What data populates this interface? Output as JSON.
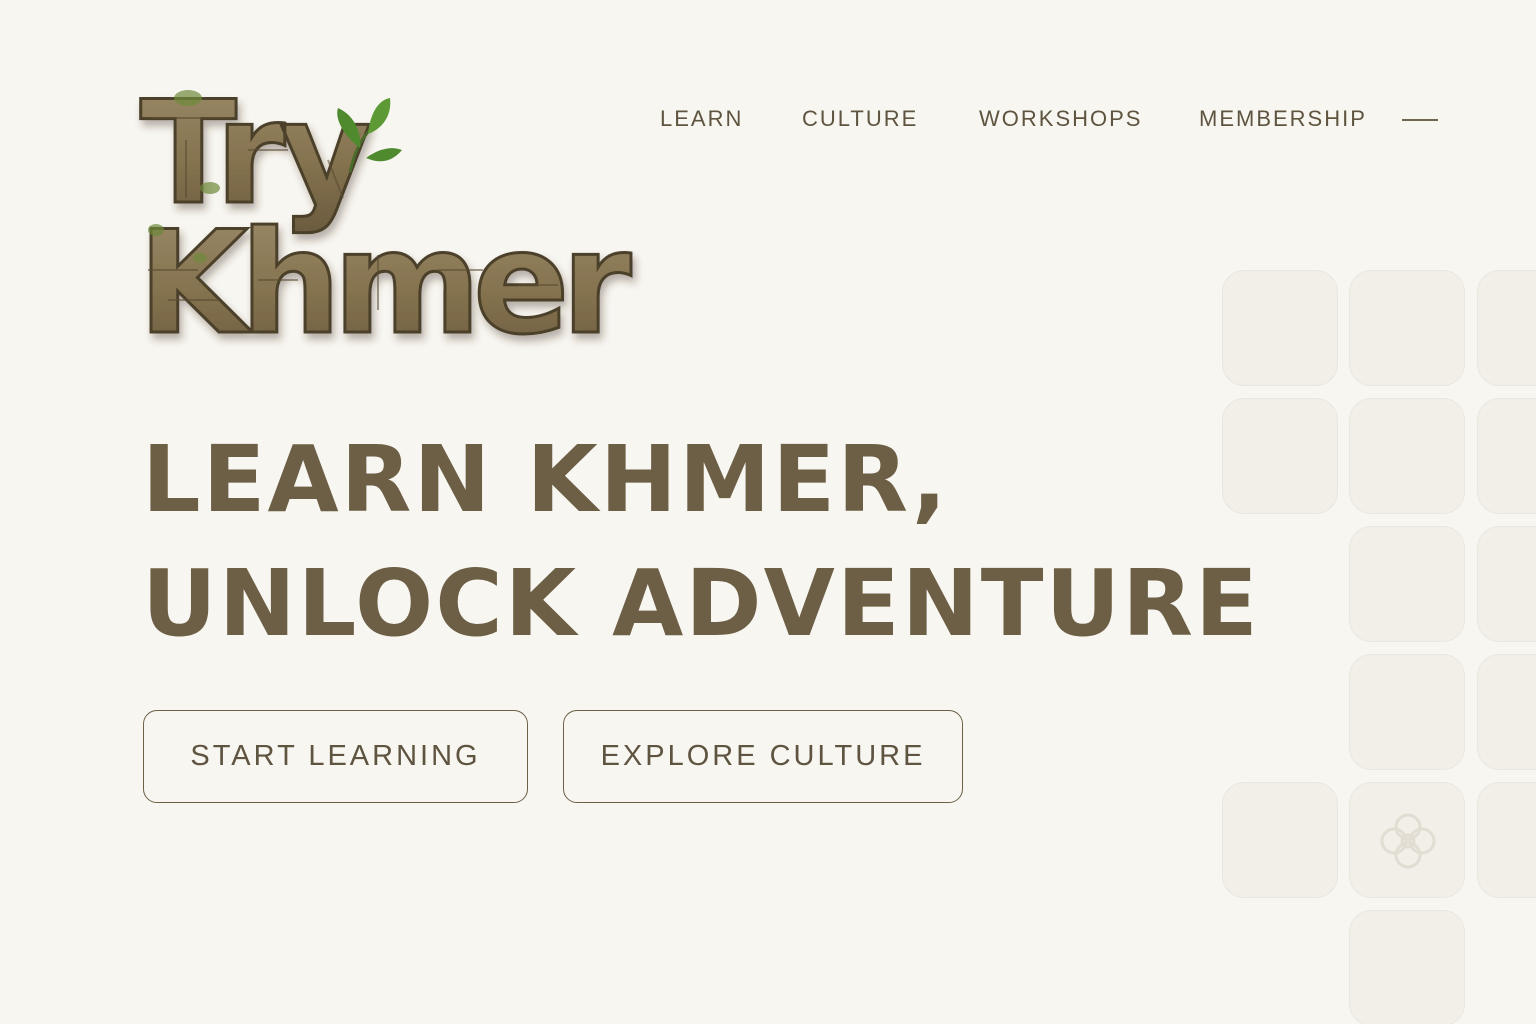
{
  "logo": {
    "line1": "Try",
    "line2": "Khmer",
    "alt": "Try Khmer",
    "icon": "leaf-sprout-icon"
  },
  "nav": {
    "items": [
      {
        "label": "LEARN"
      },
      {
        "label": "CULTURE"
      },
      {
        "label": "WORKSHOPS"
      },
      {
        "label": "MEMBERSHIP"
      }
    ],
    "menu_icon": "menu-line-icon"
  },
  "hero": {
    "line1": "LEARN KHMER,",
    "line2": "UNLOCK ADVENTURE"
  },
  "buttons": {
    "start_label": "START LEARNING",
    "explore_label": "EXPLORE CULTURE"
  },
  "decor": {
    "tile_icon": "khmer-flower-icon"
  },
  "colors": {
    "background": "#f8f6f1",
    "text": "#6d5f46",
    "stone": "#8c7a5b",
    "leaf": "#4f8a2f"
  }
}
